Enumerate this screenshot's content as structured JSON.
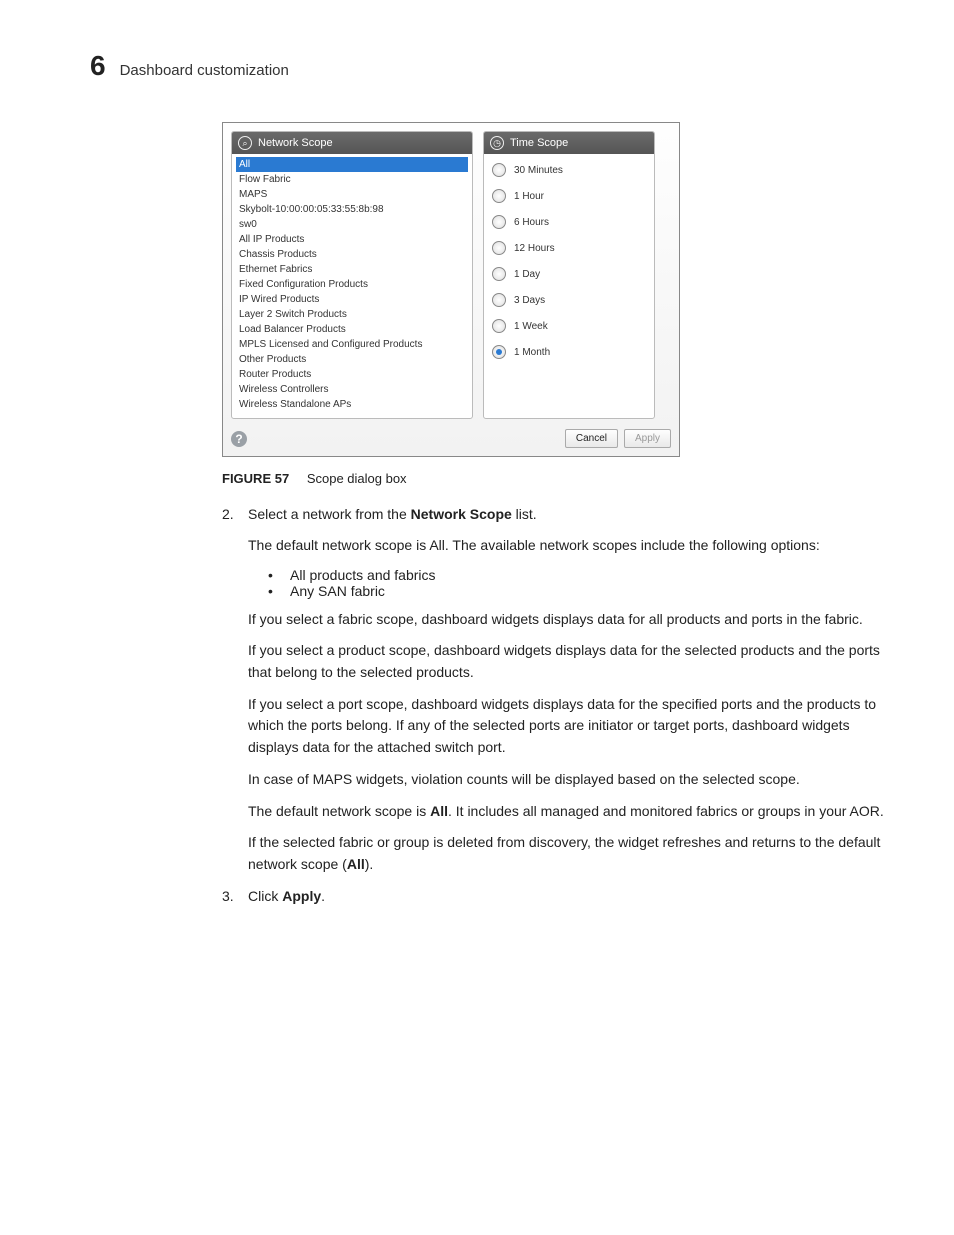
{
  "header": {
    "chapter_number": "6",
    "chapter_title": "Dashboard customization"
  },
  "dialog": {
    "network_scope": {
      "title": "Network Scope",
      "items": [
        "All",
        "Flow Fabric",
        "MAPS",
        "Skybolt-10:00:00:05:33:55:8b:98",
        "sw0",
        "All IP Products",
        "Chassis Products",
        "Ethernet Fabrics",
        "Fixed Configuration Products",
        "IP Wired Products",
        "Layer 2 Switch Products",
        "Load Balancer Products",
        "MPLS Licensed and Configured Products",
        "Other Products",
        "Router Products",
        "Wireless Controllers",
        "Wireless Standalone APs"
      ],
      "selected_index": 0
    },
    "time_scope": {
      "title": "Time Scope",
      "options": [
        "30 Minutes",
        "1 Hour",
        "6 Hours",
        "12 Hours",
        "1 Day",
        "3 Days",
        "1 Week",
        "1 Month"
      ],
      "selected_index": 7
    },
    "buttons": {
      "cancel": "Cancel",
      "apply": "Apply"
    }
  },
  "caption": {
    "figure": "FIGURE 57",
    "text": "Scope dialog box"
  },
  "steps": {
    "s2_num": "2.",
    "s2_a": "Select a network from the ",
    "s2_b": "Network Scope",
    "s2_c": " list.",
    "s3_num": "3.",
    "s3_a": "Click ",
    "s3_b": "Apply",
    "s3_c": "."
  },
  "body": {
    "p1": "The default network scope is All. The available network scopes include the following options:",
    "bullets": [
      "All products and fabrics",
      "Any SAN fabric"
    ],
    "p2": "If you select a fabric scope, dashboard widgets displays data for all products and ports in the fabric.",
    "p3": "If you select a product scope, dashboard widgets displays data for the selected products and the ports that belong to the selected products.",
    "p4": "If you select a port scope, dashboard widgets displays data for the specified ports and the products to which the ports belong. If any of the selected ports are initiator or target ports, dashboard widgets displays data for the attached switch port.",
    "p5": "In case of MAPS widgets, violation counts will be displayed based on the selected scope.",
    "p6a": "The default network scope is ",
    "p6b": "All",
    "p6c": ". It includes all managed and monitored fabrics or groups in your AOR.",
    "p7a": "If the selected fabric or group is deleted from discovery, the widget refreshes and returns to the default network scope (",
    "p7b": "All",
    "p7c": ")."
  }
}
